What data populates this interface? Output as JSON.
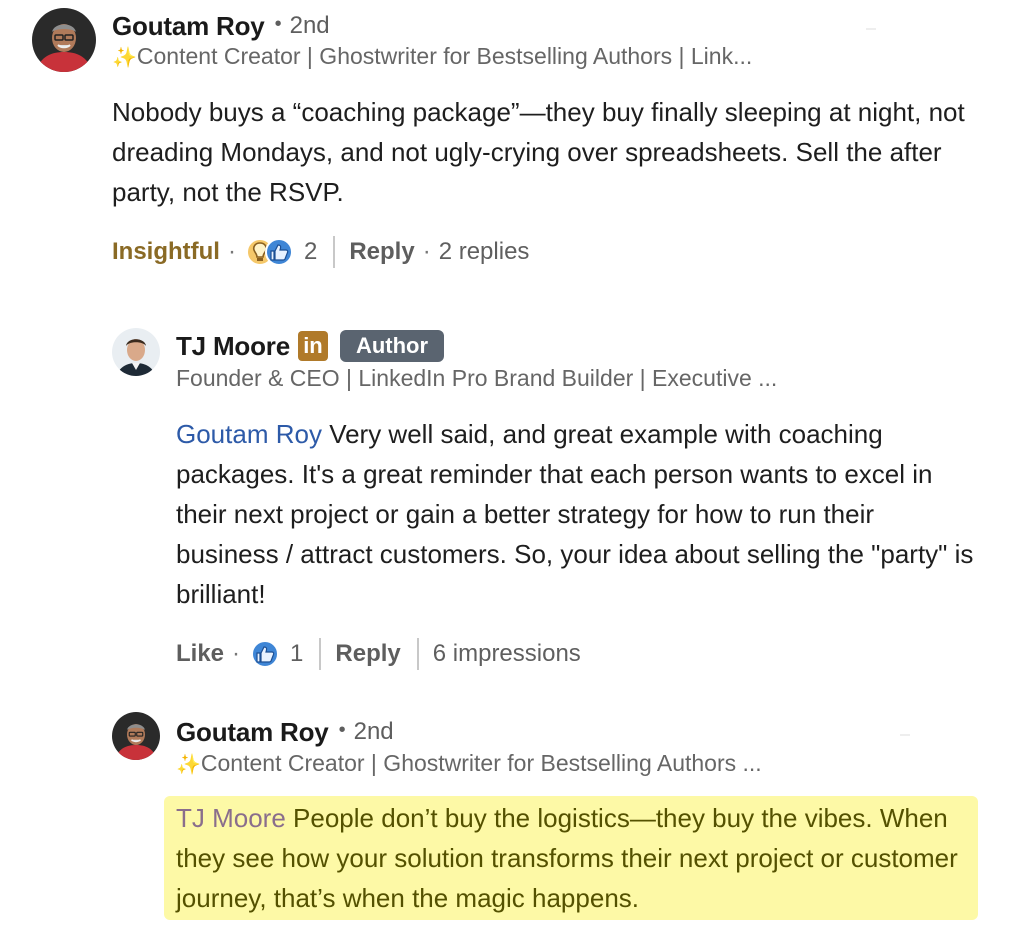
{
  "comment1": {
    "author": "Goutam Roy",
    "degree": "2nd",
    "headline": "Content Creator | Ghostwriter for Bestselling Authors | Link...",
    "body": "Nobody buys a “coaching package”—they buy finally sleeping at night, not dreading Mondays, and not ugly-crying over spreadsheets. Sell the after party, not the RSVP.",
    "reaction_label": "Insightful",
    "reaction_count": "2",
    "reply_label": "Reply",
    "replies_text": "2 replies"
  },
  "reply1": {
    "author": "TJ Moore",
    "li_badge": "in",
    "author_badge": "Author",
    "headline": "Founder & CEO | LinkedIn Pro Brand Builder | Executive ...",
    "mention": "Goutam Roy",
    "body": "Very well said, and great example with coaching packages. It's a great reminder that each person wants to excel in their next project or gain a better strategy for how to run their business / attract customers. So, your idea about selling the \"party\" is brilliant!",
    "like_label": "Like",
    "reaction_count": "1",
    "reply_label": "Reply",
    "impressions": "6 impressions"
  },
  "reply2": {
    "author": "Goutam Roy",
    "degree": "2nd",
    "headline": "Content Creator | Ghostwriter for Bestselling Authors ...",
    "mention": "TJ Moore",
    "body": "People don’t buy the logistics—they buy the vibes. When they see how your solution transforms their next project or customer journey, that’s when the magic happens."
  },
  "icons": {
    "sparkle": "✨",
    "insightful": "lightbulb-icon",
    "like": "thumbs-up-icon",
    "dot": "•",
    "middot": "·"
  },
  "colors": {
    "mention": "#2d5aa8",
    "insightful": "#8a6a25",
    "author_badge": "#5a6470",
    "li_badge": "#b07a2a",
    "highlight": "#fdf9a6"
  }
}
